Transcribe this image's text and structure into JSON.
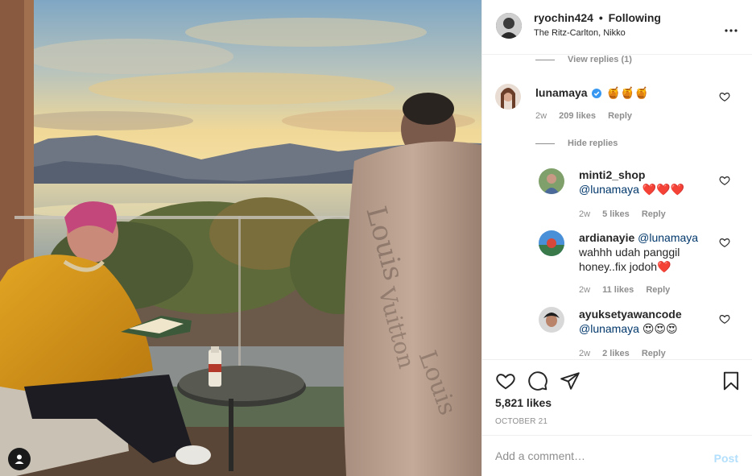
{
  "post": {
    "username": "ryochin424",
    "separator": "•",
    "follow_status": "Following",
    "location": "The Ritz-Carlton, Nikko",
    "more_icon": "more-horizontal-icon"
  },
  "comments": {
    "view_replies_label": "View replies (1)",
    "hide_replies_label": "Hide replies",
    "items": [
      {
        "username": "lunamaya",
        "verified": true,
        "text": "🍯🍯🍯",
        "age": "2w",
        "likes": "209 likes",
        "reply": "Reply"
      }
    ],
    "replies": [
      {
        "username": "minti2_shop",
        "mention": "@lunamaya",
        "text": "❤️❤️❤️",
        "age": "2w",
        "likes": "5 likes",
        "reply": "Reply"
      },
      {
        "username": "ardianayie",
        "mention": "@lunamaya",
        "text": "wahhh udah panggil honey..fix jodoh❤️",
        "age": "2w",
        "likes": "11 likes",
        "reply": "Reply"
      },
      {
        "username": "ayuksetyawancode",
        "mention": "@lunamaya",
        "text": "😍😍😍",
        "age": "2w",
        "likes": "2 likes",
        "reply": "Reply"
      }
    ]
  },
  "actions": {
    "like_icon": "heart-icon",
    "comment_icon": "comment-icon",
    "share_icon": "paper-plane-icon",
    "save_icon": "bookmark-icon",
    "likes_count": "5,821 likes",
    "date": "OCTOBER 21"
  },
  "add_comment": {
    "placeholder": "Add a comment…",
    "post_label": "Post"
  },
  "colors": {
    "text": "#262626",
    "muted": "#8e8e8e",
    "mention": "#00376b",
    "post_disabled": "#b2dffc",
    "border": "#efefef",
    "verified": "#3897f0"
  }
}
